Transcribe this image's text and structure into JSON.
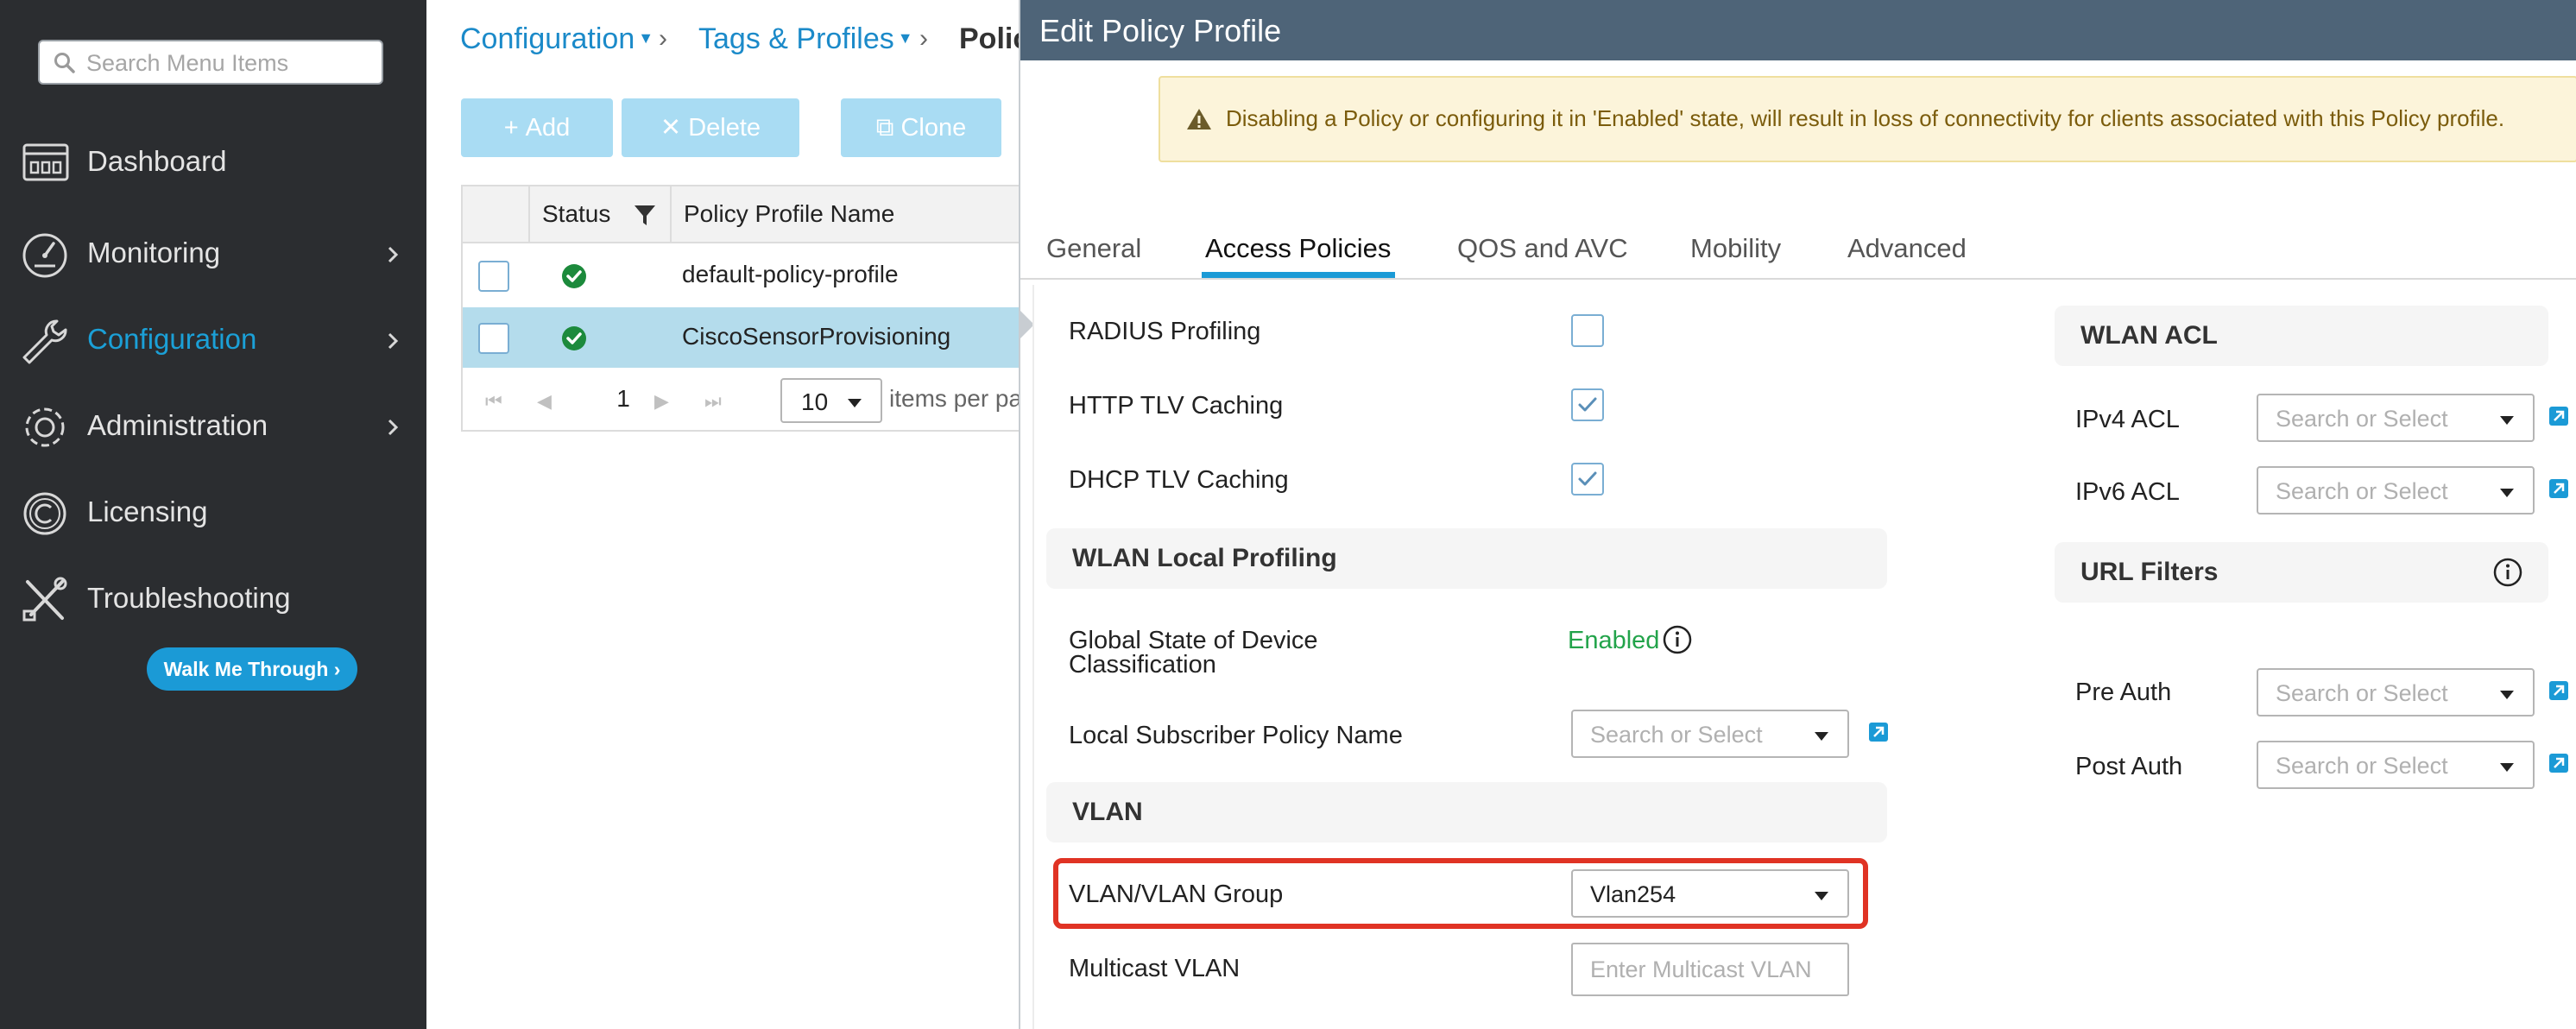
{
  "sidebar": {
    "search_placeholder": "Search Menu Items",
    "items": [
      {
        "label": "Dashboard",
        "icon": "dashboard-icon",
        "has_chevron": false
      },
      {
        "label": "Monitoring",
        "icon": "monitoring-icon",
        "has_chevron": true
      },
      {
        "label": "Configuration",
        "icon": "wrench-icon",
        "has_chevron": true,
        "active": true
      },
      {
        "label": "Administration",
        "icon": "gear-icon",
        "has_chevron": true
      },
      {
        "label": "Licensing",
        "icon": "licensing-icon",
        "has_chevron": false
      },
      {
        "label": "Troubleshooting",
        "icon": "troubleshooting-icon",
        "has_chevron": false
      }
    ],
    "walk_me_through": "Walk Me Through ›"
  },
  "breadcrumb": {
    "items": [
      "Configuration",
      "Tags & Profiles",
      "Polic"
    ]
  },
  "toolbar": {
    "add_label": "Add",
    "delete_label": "Delete",
    "clone_label": "Clone"
  },
  "table": {
    "columns": [
      "Status",
      "Policy Profile Name"
    ],
    "rows": [
      {
        "name": "default-policy-profile",
        "status": "enabled",
        "selected": false
      },
      {
        "name": "CiscoSensorProvisioning",
        "status": "enabled",
        "selected": true
      }
    ],
    "pager": {
      "page": "1",
      "page_size": "10",
      "items_per_page": "items per pa"
    }
  },
  "edit_panel": {
    "title": "Edit Policy Profile",
    "warning": "Disabling a Policy or configuring it in 'Enabled' state, will result in loss of connectivity for clients associated with this Policy profile.",
    "tabs": [
      "General",
      "Access Policies",
      "QOS and AVC",
      "Mobility",
      "Advanced"
    ],
    "active_tab": "Access Policies",
    "left": {
      "radius_profiling": {
        "label": "RADIUS Profiling",
        "checked": false
      },
      "http_tlv_caching": {
        "label": "HTTP TLV Caching",
        "checked": true
      },
      "dhcp_tlv_caching": {
        "label": "DHCP TLV Caching",
        "checked": true
      },
      "wlan_local_profiling": {
        "title": "WLAN Local Profiling",
        "global_state_label_1": "Global State of Device",
        "global_state_label_2": "Classification",
        "global_state_value": "Enabled",
        "subscriber_policy_label": "Local Subscriber Policy Name",
        "subscriber_policy_placeholder": "Search or Select"
      },
      "vlan": {
        "title": "VLAN",
        "vlan_group_label": "VLAN/VLAN Group",
        "vlan_group_value": "Vlan254",
        "multicast_label": "Multicast VLAN",
        "multicast_placeholder": "Enter Multicast VLAN"
      }
    },
    "right": {
      "wlan_acl": {
        "title": "WLAN ACL",
        "ipv4_label": "IPv4 ACL",
        "ipv4_placeholder": "Search or Select",
        "ipv6_label": "IPv6 ACL",
        "ipv6_placeholder": "Search or Select"
      },
      "url_filters": {
        "title": "URL Filters",
        "pre_auth_label": "Pre Auth",
        "pre_auth_placeholder": "Search or Select",
        "post_auth_label": "Post Auth",
        "post_auth_placeholder": "Search or Select"
      }
    }
  },
  "colors": {
    "sidebar_bg": "#2b2d30",
    "accent": "#1b9ad6",
    "header_bg": "#4e6478",
    "highlight": "#e03324",
    "enabled_green": "#22a34a"
  }
}
